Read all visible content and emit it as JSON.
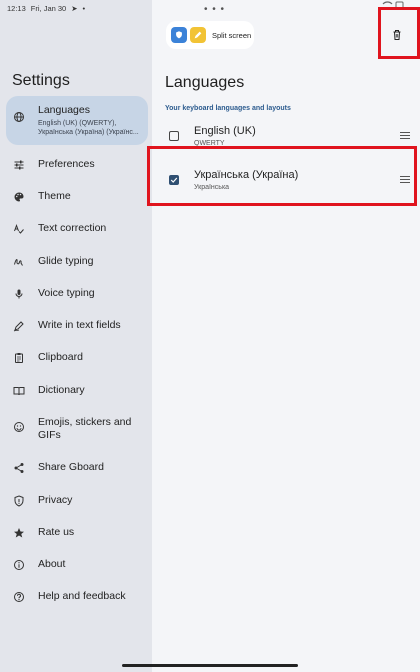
{
  "status": {
    "time": "12:13",
    "date": "Fri, Jan 30"
  },
  "settings_title": "Settings",
  "nav": [
    {
      "id": "languages",
      "label": "Languages",
      "sub": "English (UK) (QWERTY),\nУкраїнська (Україна) (Українс...",
      "icon": "globe-icon"
    },
    {
      "id": "preferences",
      "label": "Preferences",
      "icon": "sliders-icon"
    },
    {
      "id": "theme",
      "label": "Theme",
      "icon": "palette-icon"
    },
    {
      "id": "text-correction",
      "label": "Text correction",
      "icon": "spellcheck-icon"
    },
    {
      "id": "glide-typing",
      "label": "Glide typing",
      "icon": "gesture-icon"
    },
    {
      "id": "voice-typing",
      "label": "Voice typing",
      "icon": "mic-icon"
    },
    {
      "id": "write-in-text-fields",
      "label": "Write in text fields",
      "icon": "pen-icon"
    },
    {
      "id": "clipboard",
      "label": "Clipboard",
      "icon": "clipboard-icon"
    },
    {
      "id": "dictionary",
      "label": "Dictionary",
      "icon": "book-icon"
    },
    {
      "id": "emojis",
      "label": "Emojis, stickers and GIFs",
      "icon": "emoji-icon"
    },
    {
      "id": "share",
      "label": "Share Gboard",
      "icon": "share-icon"
    },
    {
      "id": "privacy",
      "label": "Privacy",
      "icon": "shield-icon"
    },
    {
      "id": "rate",
      "label": "Rate us",
      "icon": "star-icon"
    },
    {
      "id": "about",
      "label": "About",
      "icon": "info-icon"
    },
    {
      "id": "help",
      "label": "Help and feedback",
      "icon": "help-icon"
    }
  ],
  "split_screen_label": "Split screen",
  "languages": {
    "title": "Languages",
    "subtitle": "Your keyboard languages and layouts",
    "items": [
      {
        "name": "English (UK)",
        "detail": "QWERTY",
        "checked": false
      },
      {
        "name": "Українська (Україна)",
        "detail": "Українська",
        "checked": true
      }
    ]
  },
  "colors": {
    "highlight": "#e0141e",
    "active_nav": "#c7d5e6",
    "accent": "#2f4f72"
  }
}
